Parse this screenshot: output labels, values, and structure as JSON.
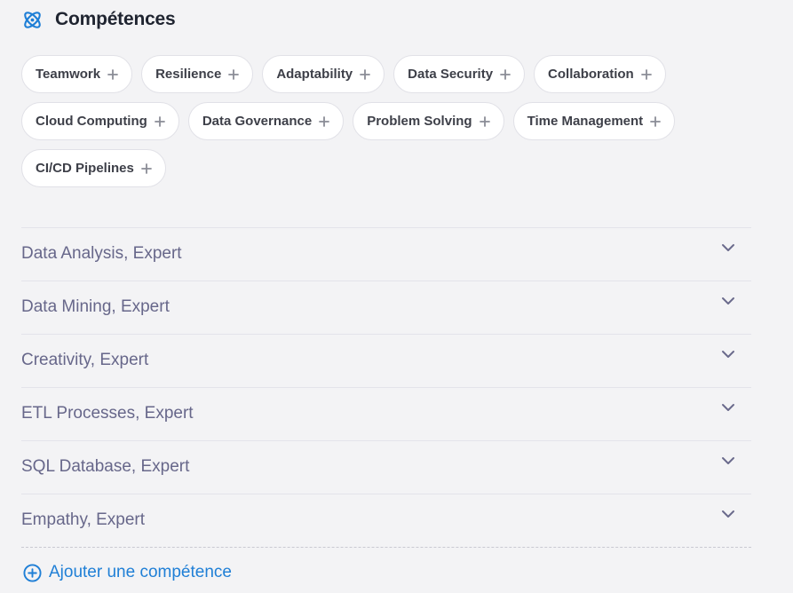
{
  "header": {
    "title": "Compétences",
    "icon": "atom-icon",
    "accent": "#1f7fd6"
  },
  "suggested_skills": [
    [
      "Teamwork",
      "Resilience",
      "Adaptability",
      "Data Security",
      "Collaboration"
    ],
    [
      "Cloud Computing",
      "Data Governance",
      "Problem Solving",
      "Time Management"
    ],
    [
      "CI/CD Pipelines"
    ]
  ],
  "skills": [
    {
      "label": "Data Analysis, Expert"
    },
    {
      "label": "Data Mining, Expert"
    },
    {
      "label": "Creativity, Expert"
    },
    {
      "label": "ETL Processes, Expert"
    },
    {
      "label": "SQL Database, Expert"
    },
    {
      "label": "Empathy, Expert"
    }
  ],
  "add_skill": {
    "label": "Ajouter une compétence",
    "icon": "plus-circle-icon"
  }
}
